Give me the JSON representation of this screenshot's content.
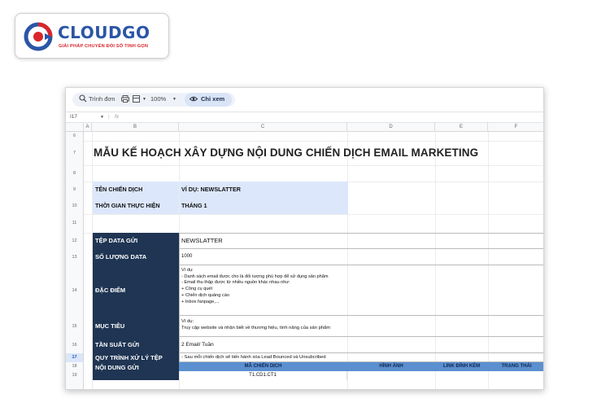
{
  "logo": {
    "name": "CLOUDGO",
    "tagline": "GIẢI PHÁP CHUYỂN ĐỔI SỐ TINH GỌN",
    "colors": {
      "blue": "#2b56a6",
      "red": "#d8262b"
    }
  },
  "toolbar": {
    "menu_label": "Trình đơn",
    "zoom": "100%",
    "view_mode": "Chỉ xem"
  },
  "formula_bar": {
    "cell_ref": "I17",
    "fx": "fx"
  },
  "columns": [
    "A",
    "B",
    "C",
    "D",
    "E",
    "F"
  ],
  "rows": [
    "6",
    "7",
    "8",
    "9",
    "10",
    "11",
    "12",
    "13",
    "14",
    "15",
    "16",
    "17",
    "18",
    "19"
  ],
  "sheet": {
    "title": "MẪU KẾ HOẠCH XÂY DỰNG NỘI DUNG CHIẾN DỊCH EMAIL MARKETING",
    "campaign_name_label": "TÊN CHIẾN DỊCH",
    "campaign_name_value": "VÍ DỤ: NEWSLATTER",
    "time_label": "THỜI GIAN THỰC HIỆN",
    "time_value": "THÁNG 1",
    "data_file_label": "TỆP DATA GỬI",
    "data_file_value": "NEWSLATTER",
    "data_count_label": "SỐ LƯỢNG DATA",
    "data_count_value": "1000",
    "features_label": "ĐẶC ĐIỂM",
    "features_value": [
      "Ví dụ:",
      "- Danh sách email được cho là đối tượng phù hợp để sử dụng sản phẩm",
      "- Email thu thập được từ nhiều nguồn khác nhau như:",
      "+ Công cụ quét",
      "+ Chiến dịch quảng cáo",
      "+ Inbox fanpage,..."
    ],
    "goal_label": "MỤC TIÊU",
    "goal_value": [
      "Ví dụ:",
      "Truy cập website và nhận biết về thương hiệu, tính năng của sản phẩm"
    ],
    "frequency_label": "TẦN SUẤT GỬI",
    "frequency_value": "2 Email/ Tuần",
    "process_label": "QUY TRÌNH XỬ LÝ TỆP",
    "process_value": "- Sau mỗi chiến dịch sẽ tiến hành xóa Lead Bounced và Unsubcribed",
    "content_label": "NỘI DUNG GỬI",
    "content_headers": [
      "MÃ CHIẾN DỊCH",
      "HÌNH ẢNH",
      "LINK ĐÍNH KÈM",
      "TRẠNG THÁI"
    ],
    "content_row": "T1.CD1.CT1"
  }
}
